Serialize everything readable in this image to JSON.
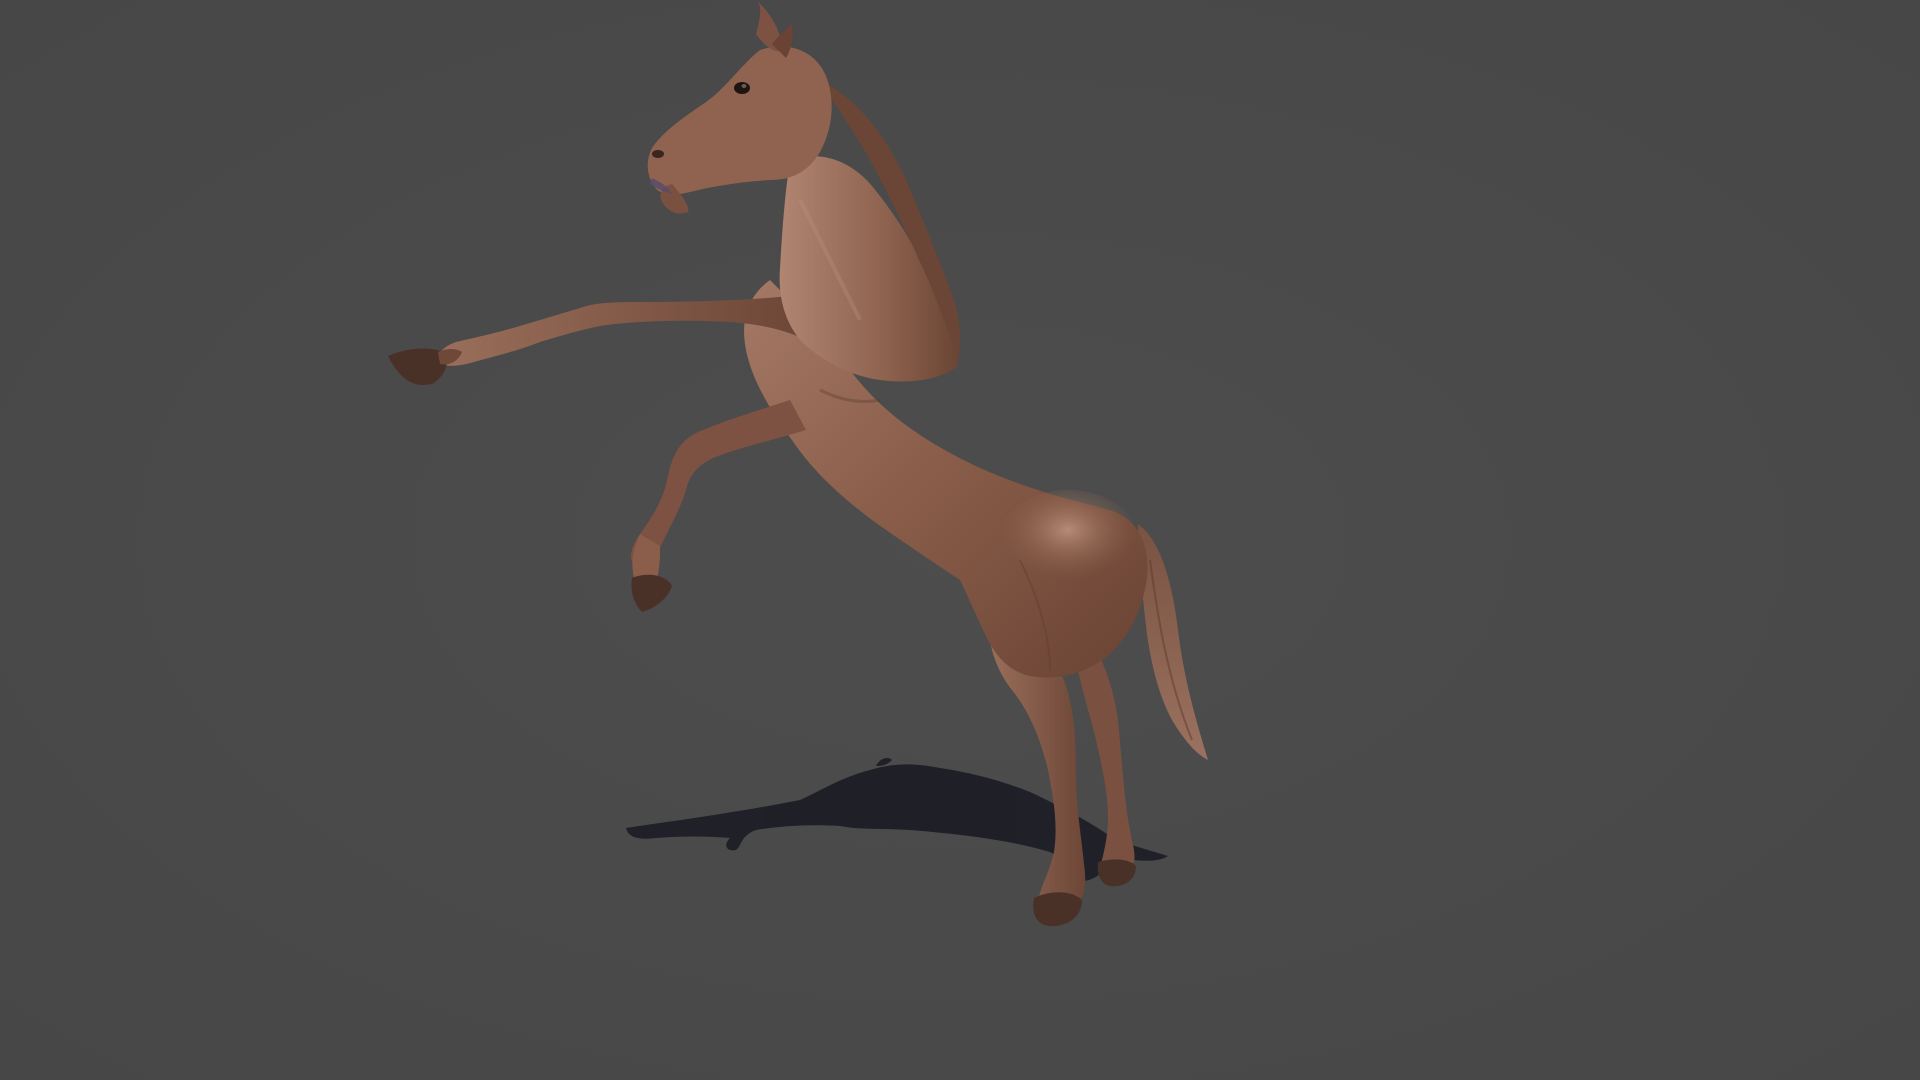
{
  "viewport": {
    "background_color": "#4a4a4a"
  },
  "model": {
    "icon": "horse-model-icon",
    "pose": "rearing",
    "coat_color": "#8a5e4a",
    "coat_highlight": "#b08672",
    "coat_shadow": "#5c3a2c",
    "hoof_color": "#4a3128",
    "mane_color": "#6b4636"
  },
  "shadow": {
    "color": "#1c1d25"
  }
}
